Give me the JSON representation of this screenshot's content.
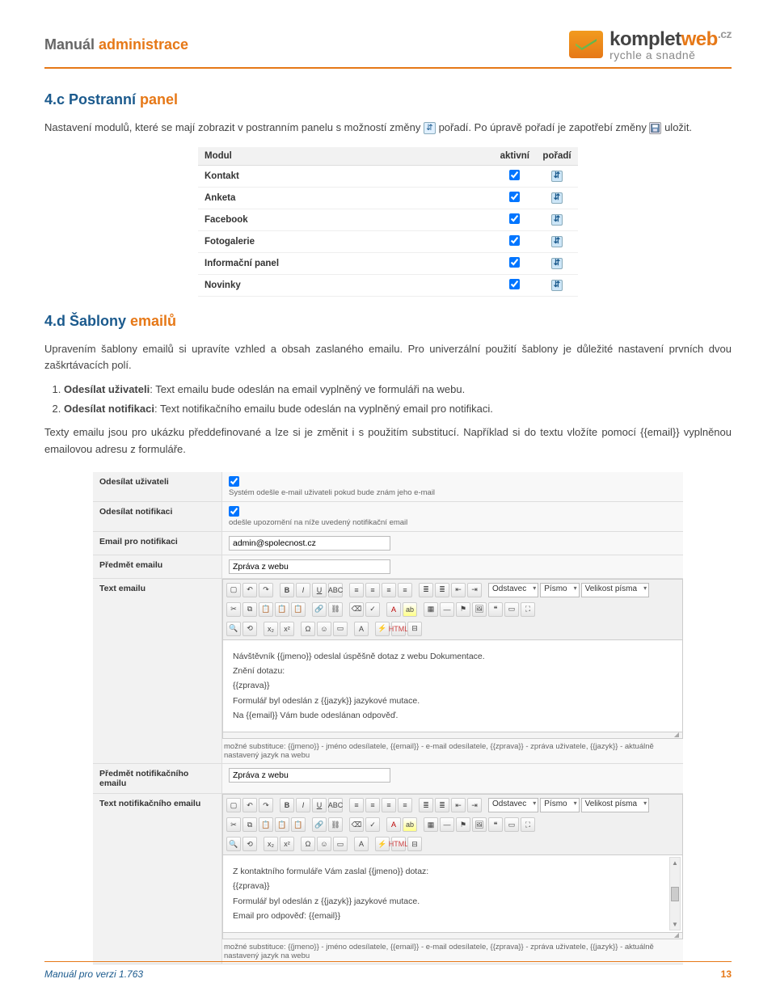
{
  "header": {
    "title_a": "Manuál ",
    "title_b": "administrace",
    "logo_line1_a": "komplet",
    "logo_line1_b": "web",
    "logo_line1_c": ".cz",
    "logo_line2": "rychle a snadně"
  },
  "section1": {
    "heading_a": "4.c Postranní ",
    "heading_b": "panel",
    "para_1a": "Nastavení modulů, které se mají zobrazit v postranním panelu s možností změny ",
    "para_1b": " pořadí. Po úpravě pořadí je zapotřebí změny ",
    "para_1c": " uložit."
  },
  "modules_table": {
    "col_module": "Modul",
    "col_active": "aktivní",
    "col_order": "pořadí",
    "rows": [
      {
        "name": "Kontakt"
      },
      {
        "name": "Anketa"
      },
      {
        "name": "Facebook"
      },
      {
        "name": "Fotogalerie"
      },
      {
        "name": "Informační panel"
      },
      {
        "name": "Novinky"
      }
    ]
  },
  "section2": {
    "heading_a": "4.d Šablony ",
    "heading_b": "emailů",
    "para1": "Upravením šablony emailů si upravíte vzhled a obsah zaslaného emailu. Pro univerzální použití šablony je důležité nastavení prvních dvou zaškrtávacích polí.",
    "list": {
      "item1_strong": "Odesílat uživateli",
      "item1_rest": ": Text emailu bude odeslán na email vyplněný ve formuláři na webu.",
      "item2_strong": "Odesílat notifikaci",
      "item2_rest": ": Text notifikačního emailu bude odeslán na vyplněný email pro notifikaci."
    },
    "para2": "Texty emailu jsou pro ukázku předdefinované a lze si je změnit i s použitím substitucí. Například si do textu vložíte pomocí {{email}} vyplněnou emailovou adresu z formuláře."
  },
  "settings": {
    "row1_label": "Odesílat uživateli",
    "row1_hint": "Systém odešle e-mail uživateli pokud bude znám jeho e-mail",
    "row2_label": "Odesílat notifikaci",
    "row2_hint": "odešle upozornění na níže uvedený notifikační email",
    "row3_label": "Email pro notifikaci",
    "row3_value": "admin@spolecnost.cz",
    "row4_label": "Předmět emailu",
    "row4_value": "Zpráva z webu",
    "row5_label": "Text emailu",
    "row6_label": "Předmět notifikačního emailu",
    "row6_value": "Zpráva z webu",
    "row7_label": "Text notifikačního emailu",
    "subst_hint": "možné substituce: {{jmeno}} - jméno odesílatele, {{email}} - e-mail odesílatele, {{zprava}} - zpráva uživatele, {{jazyk}} - aktuálně nastavený jazyk na webu",
    "toolbar_selects": {
      "style": "Odstavec",
      "font": "Písmo",
      "size": "Velikost písma"
    },
    "editor1_lines": [
      "Návštěvník {{jmeno}} odeslal úspěšně dotaz z webu Dokumentace.",
      "Znění dotazu:",
      "{{zprava}}",
      "Formulář byl odeslán z {{jazyk}} jazykové mutace.",
      "Na {{email}} Vám bude odeslánan odpověď."
    ],
    "editor2_lines": [
      "Z kontaktního formuláře Vám zaslal {{jmeno}} dotaz:",
      "{{zprava}}",
      "Formulář byl odeslán z {{jazyk}} jazykové mutace.",
      "Email pro odpověď: {{email}}"
    ]
  },
  "footer": {
    "text": "Manuál pro verzi 1.763",
    "page": "13"
  }
}
